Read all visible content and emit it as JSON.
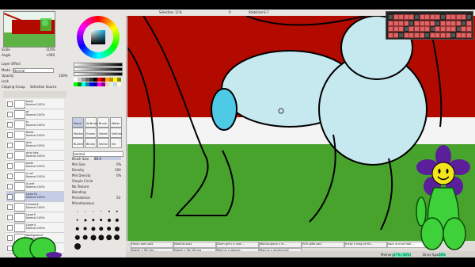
{
  "toolbar": {
    "selection_label": "Selection",
    "zoom_value": "11%",
    "angle_value": "0",
    "stabilizer_label": "Stabilizer",
    "stabilizer_value": "S-7"
  },
  "navigator": {
    "scale_label": "Scale",
    "scale_value": "116%",
    "angle_label": "Angle",
    "angle_value": "+000"
  },
  "layer_panel": {
    "effect_label": "Layer Effect",
    "mode_label": "Mode",
    "mode_value": "Normal",
    "opacity_label": "Opacity",
    "opacity_value": "100%",
    "lock_label": "Lock",
    "clipping_label": "Clipping Group",
    "selection_source_label": "Selection Source",
    "layers": [
      {
        "name": "body",
        "mode": "Normal",
        "opacity": "100%"
      },
      {
        "name": "gf",
        "mode": "Normal",
        "opacity": "100%"
      },
      {
        "name": "fs",
        "mode": "Normal",
        "opacity": "100%"
      },
      {
        "name": "Bdick",
        "mode": "Normal",
        "opacity": "100%"
      },
      {
        "name": "dick",
        "mode": "Normal",
        "opacity": "100%"
      },
      {
        "name": "dirty bits",
        "mode": "Normal",
        "opacity": "100%"
      },
      {
        "name": "teeth",
        "mode": "Normal",
        "opacity": "100%"
      },
      {
        "name": "d roll",
        "mode": "Normal",
        "opacity": "100%"
      },
      {
        "name": "d pref",
        "mode": "Normal",
        "opacity": "100%"
      },
      {
        "name": "Layer10",
        "mode": "Normal",
        "opacity": "100%"
      },
      {
        "name": "Linework",
        "mode": "Normal",
        "opacity": "100%"
      },
      {
        "name": "Layer5",
        "mode": "Normal",
        "opacity": "100%"
      },
      {
        "name": "Layer4",
        "mode": "Normal",
        "opacity": "100%"
      },
      {
        "name": "background",
        "mode": "Normal",
        "opacity": "100%"
      },
      {
        "name": "Layer19",
        "mode": "Normal",
        "opacity": "100%"
      }
    ]
  },
  "brush_settings": {
    "mode_value": "normal",
    "brush_size_label": "Brush Size",
    "brush_size_value": "86.0",
    "min_size_label": "Min Size",
    "min_size_value": "0%",
    "density_label": "Density",
    "density_value": "100",
    "min_density_label": "Min Density",
    "min_density_value": "0%",
    "simple_circle": "Simple Circle",
    "no_texture": "No Texture",
    "blending_label": "Blending",
    "persistence_label": "Persistence",
    "persistence_value": "50",
    "advanced_label": "Miscellaneous",
    "size_values": [
      "0.7",
      "0.8",
      "1",
      "1.5",
      "2",
      "2.3",
      "2.6",
      "3",
      "3.5",
      "4",
      "5",
      "6",
      "7",
      "8",
      "9",
      "10",
      "12",
      "14",
      "16",
      "20",
      "25",
      "30",
      "35",
      "40",
      "50"
    ]
  },
  "tool_names": [
    "Pencil",
    "AirBrush",
    "Brush",
    "Water",
    "Marker",
    "Eraser",
    "Select",
    "SelEras",
    "Bucket",
    "Binary",
    "Vector",
    "Ink"
  ],
  "tabs_row1": [
    "Hang room.sai2",
    "NewCanvas1",
    "Dorm girl's a new ...",
    "Mondo-plane x m...",
    "YGH gifts.sai2",
    "tricky x king of hill...",
    "lapis and peridot ..."
  ],
  "tabs_row2": [
    "Noemi x Tali bar ...",
    "Noemi x Tali NF.png",
    "Marcus x pepper...",
    "Marcus x jaiyaky.sai2"
  ],
  "status": {
    "memory_label": "Memory Usage",
    "memory_value": "57% (58%)",
    "drive_label": "Drive Space",
    "drive_value": "68%"
  },
  "colors": {
    "canvas_red": "#b30a00",
    "canvas_green": "#48a32c",
    "canvas_white": "#f4f4f4",
    "skin_blue": "#c6e8ef",
    "accent_blue": "#4ec9e6",
    "flower_purple": "#5b1f9c",
    "flower_center": "#f2e51c",
    "flower_body": "#3fd13a"
  }
}
